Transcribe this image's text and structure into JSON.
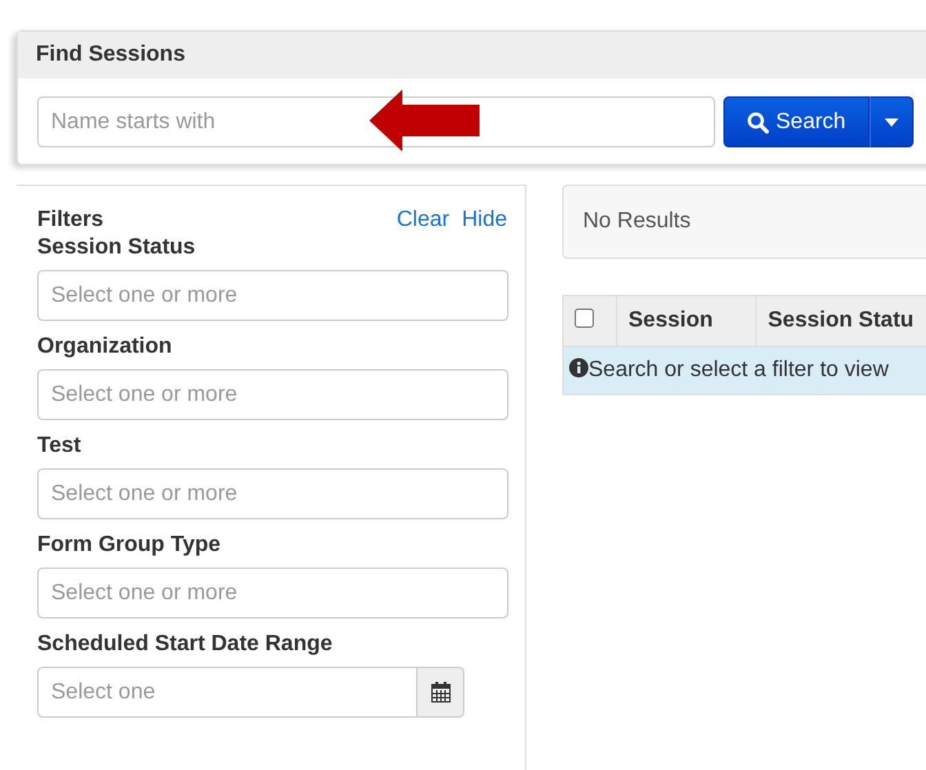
{
  "panel": {
    "title": "Find Sessions"
  },
  "search": {
    "placeholder": "Name starts with",
    "button": "Search"
  },
  "filters": {
    "title": "Filters",
    "actions": [
      "Clear",
      "Hide"
    ],
    "groups": [
      {
        "label": "Session Status",
        "placeholder": "Select one or more",
        "kind": "multi"
      },
      {
        "label": "Organization",
        "placeholder": "Select one or more",
        "kind": "multi"
      },
      {
        "label": "Test",
        "placeholder": "Select one or more",
        "kind": "multi"
      },
      {
        "label": "Form Group Type",
        "placeholder": "Select one or more",
        "kind": "multi"
      },
      {
        "label": "Scheduled Start Date Range",
        "placeholder": "Select one",
        "kind": "date"
      }
    ]
  },
  "results": {
    "status": "No Results",
    "table": {
      "select_all": {
        "checked": false
      },
      "columns": [
        "Session",
        "Session Statu"
      ],
      "message": "Search or select a filter to view"
    }
  }
}
